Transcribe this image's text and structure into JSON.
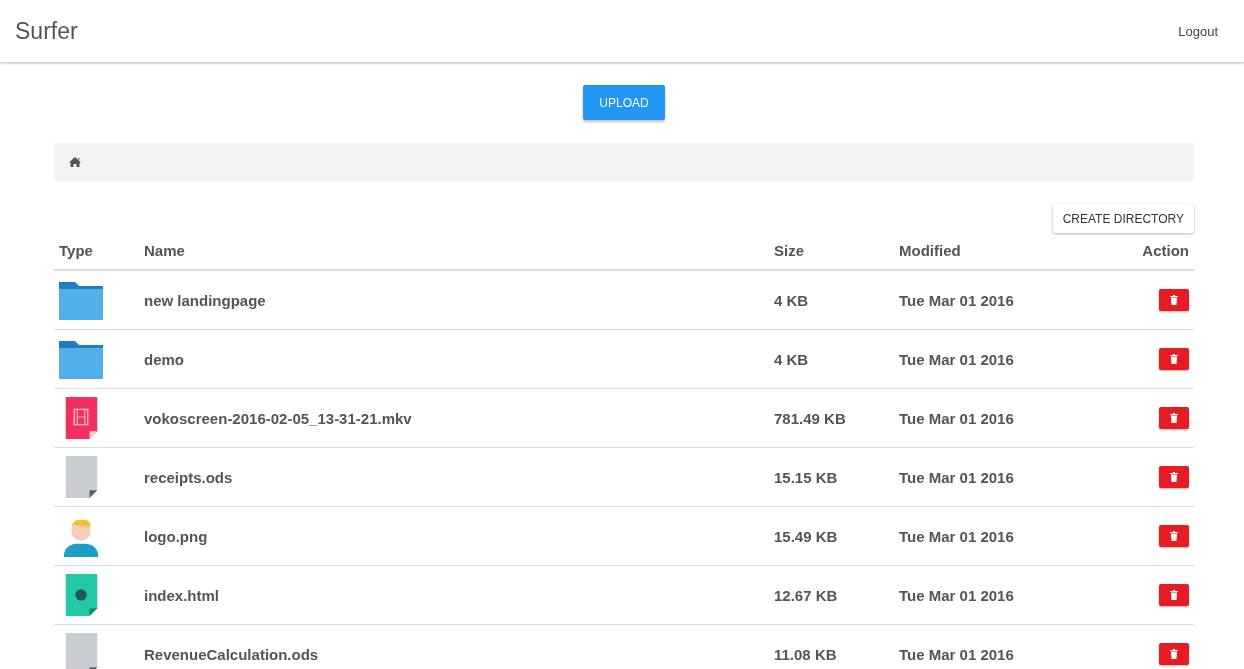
{
  "navbar": {
    "brand": "Surfer",
    "logout": "Logout"
  },
  "upload_button": "UPLOAD",
  "create_directory_button": "CREATE DIRECTORY",
  "table": {
    "columns": [
      "Type",
      "Name",
      "Size",
      "Modified",
      "Action"
    ],
    "rows": [
      {
        "kind": "folder",
        "name": "new landingpage",
        "size": "4 KB",
        "modified": "Tue Mar 01 2016"
      },
      {
        "kind": "folder",
        "name": "demo",
        "size": "4 KB",
        "modified": "Tue Mar 01 2016"
      },
      {
        "kind": "video",
        "name": "vokoscreen-2016-02-05_13-31-21.mkv",
        "size": "781.49 KB",
        "modified": "Tue Mar 01 2016"
      },
      {
        "kind": "document",
        "name": "receipts.ods",
        "size": "15.15 KB",
        "modified": "Tue Mar 01 2016"
      },
      {
        "kind": "image",
        "name": "logo.png",
        "size": "15.49 KB",
        "modified": "Tue Mar 01 2016"
      },
      {
        "kind": "web",
        "name": "index.html",
        "size": "12.67 KB",
        "modified": "Tue Mar 01 2016"
      },
      {
        "kind": "document",
        "name": "RevenueCalculation.ods",
        "size": "11.08 KB",
        "modified": "Tue Mar 01 2016"
      }
    ]
  }
}
